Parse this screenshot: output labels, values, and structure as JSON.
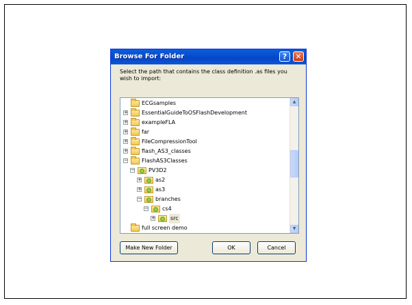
{
  "dialog": {
    "title": "Browse For Folder",
    "help_glyph": "?",
    "close_glyph": "✕",
    "prompt": "Select the path that contains the class definition .as files you wish to import:"
  },
  "tree": {
    "items": [
      {
        "label": "ECGsamples",
        "expander": "",
        "icon": "folder-icon",
        "level": 0
      },
      {
        "label": "EssentialGuideToOSFlashDevelopment",
        "expander": "+",
        "icon": "folder-icon",
        "level": 0
      },
      {
        "label": "exampleFLA",
        "expander": "+",
        "icon": "folder-icon",
        "level": 0
      },
      {
        "label": "far",
        "expander": "+",
        "icon": "folder-icon",
        "level": 0
      },
      {
        "label": "FileCompressionTool",
        "expander": "+",
        "icon": "folder-icon",
        "level": 0
      },
      {
        "label": "flash_AS3_classes",
        "expander": "+",
        "icon": "folder-icon",
        "level": 0
      },
      {
        "label": "FlashAS3Classes",
        "expander": "−",
        "icon": "folder-icon",
        "level": 0
      },
      {
        "label": "PV3D2",
        "expander": "−",
        "icon": "svn-folder-icon",
        "level": 1
      },
      {
        "label": "as2",
        "expander": "+",
        "icon": "svn-folder-icon",
        "level": 2
      },
      {
        "label": "as3",
        "expander": "+",
        "icon": "svn-folder-icon",
        "level": 2
      },
      {
        "label": "branches",
        "expander": "−",
        "icon": "svn-folder-icon",
        "level": 2
      },
      {
        "label": "cs4",
        "expander": "−",
        "icon": "svn-folder-icon",
        "level": 3
      },
      {
        "label": "src",
        "expander": "+",
        "icon": "svn-folder-icon",
        "level": 4,
        "selected": true
      },
      {
        "label": "full screen demo",
        "expander": "",
        "icon": "folder-icon",
        "level": 0
      }
    ],
    "scroll_up_glyph": "▲",
    "scroll_down_glyph": "▼"
  },
  "buttons": {
    "make_new_folder": "Make New Folder",
    "ok": "OK",
    "cancel": "Cancel"
  }
}
